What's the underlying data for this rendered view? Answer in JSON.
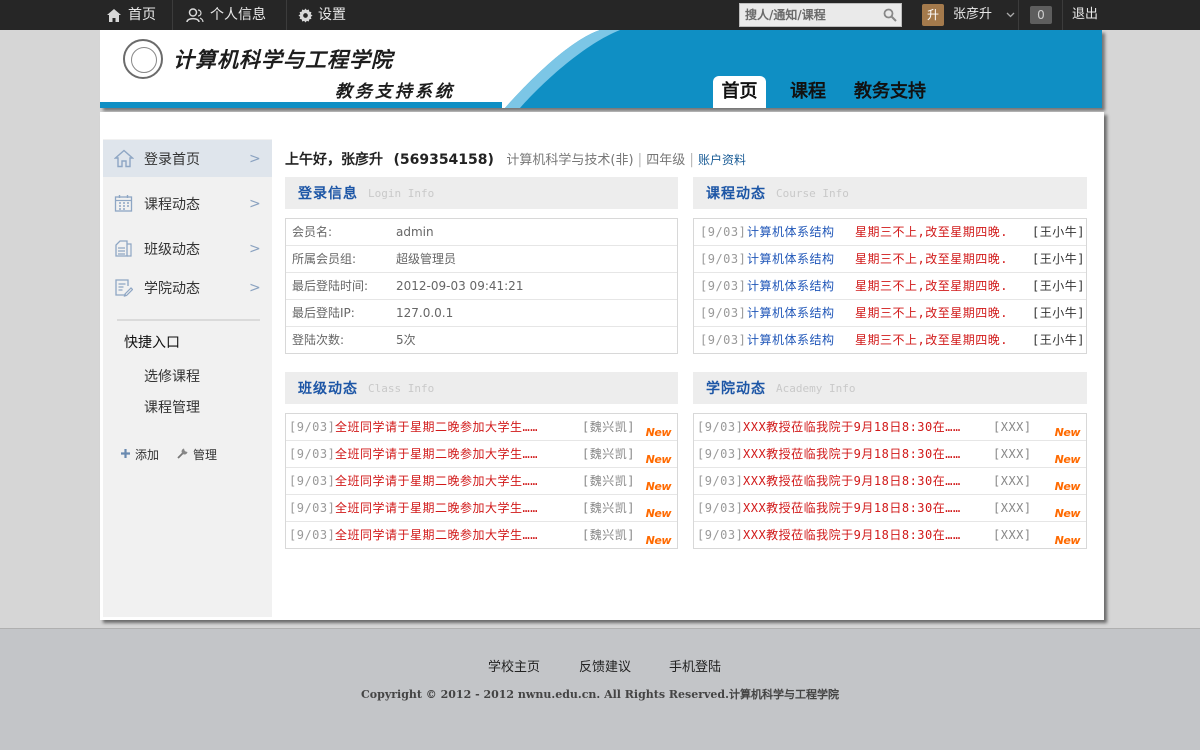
{
  "topbar": {
    "home_label": "首页",
    "profile_label": "个人信息",
    "settings_label": "设置",
    "search_placeholder": "搜人/通知/课程",
    "avatar_text": "升",
    "user_name": "张彦升",
    "notification_count": "0",
    "logout_label": "退出"
  },
  "header": {
    "site_title": "计算机科学与工程学院",
    "site_subtitle": "教务支持系统",
    "tabs": [
      "首页",
      "课程",
      "教务支持"
    ],
    "active_tab": "首页",
    "colors": {
      "banner": "#0f8fc4",
      "topbar": "#262626"
    }
  },
  "sidebar": {
    "items": [
      {
        "label": "登录首页",
        "arrow": ">",
        "icon": "home-icon"
      },
      {
        "label": "课程动态",
        "arrow": ">",
        "icon": "calendar-icon"
      },
      {
        "label": "班级动态",
        "arrow": ">",
        "icon": "class-icon"
      },
      {
        "label": "学院动态",
        "arrow": ">",
        "icon": "edit-icon"
      }
    ],
    "quick_title": "快捷入口",
    "quick_links": [
      "选修课程",
      "课程管理"
    ],
    "add_label": "添加",
    "manage_label": "管理"
  },
  "greeting": {
    "hello": "上午好，张彦升",
    "student_id": "(569354158)",
    "major": "计算机科学与技术(非)",
    "grade": "四年级",
    "account_link": "账户资料"
  },
  "login_info": {
    "title": "登录信息",
    "title_en": "Login Info",
    "rows": [
      {
        "key": "会员名:",
        "value": "admin"
      },
      {
        "key": "所属会员组:",
        "value": "超级管理员"
      },
      {
        "key": "最后登陆时间:",
        "value": "2012-09-03 09:41:21"
      },
      {
        "key": "最后登陆IP:",
        "value": "127.0.0.1"
      },
      {
        "key": "登陆次数:",
        "value": "5次"
      }
    ]
  },
  "course_news": {
    "title": "课程动态",
    "title_en": "Course Info",
    "rows": [
      {
        "date": "[9/03]",
        "course": "计算机体系结构",
        "text": "星期三不上,改至星期四晚.",
        "author": "[王小牛]"
      },
      {
        "date": "[9/03]",
        "course": "计算机体系结构",
        "text": "星期三不上,改至星期四晚.",
        "author": "[王小牛]"
      },
      {
        "date": "[9/03]",
        "course": "计算机体系结构",
        "text": "星期三不上,改至星期四晚.",
        "author": "[王小牛]"
      },
      {
        "date": "[9/03]",
        "course": "计算机体系结构",
        "text": "星期三不上,改至星期四晚.",
        "author": "[王小牛]"
      },
      {
        "date": "[9/03]",
        "course": "计算机体系结构",
        "text": "星期三不上,改至星期四晚.",
        "author": "[王小牛]"
      }
    ]
  },
  "class_news": {
    "title": "班级动态",
    "title_en": "Class Info",
    "rows": [
      {
        "date": "[9/03]",
        "text": "全班同学请于星期二晚参加大学生……",
        "author": "[魏兴凯]",
        "badge": "New"
      },
      {
        "date": "[9/03]",
        "text": "全班同学请于星期二晚参加大学生……",
        "author": "[魏兴凯]",
        "badge": "New"
      },
      {
        "date": "[9/03]",
        "text": "全班同学请于星期二晚参加大学生……",
        "author": "[魏兴凯]",
        "badge": "New"
      },
      {
        "date": "[9/03]",
        "text": "全班同学请于星期二晚参加大学生……",
        "author": "[魏兴凯]",
        "badge": "New"
      },
      {
        "date": "[9/03]",
        "text": "全班同学请于星期二晚参加大学生……",
        "author": "[魏兴凯]",
        "badge": "New"
      }
    ]
  },
  "academy_news": {
    "title": "学院动态",
    "title_en": "Academy Info",
    "rows": [
      {
        "date": "[9/03]",
        "text": "XXX教授莅临我院于9月18日8:30在……",
        "author": "[XXX]",
        "badge": "New"
      },
      {
        "date": "[9/03]",
        "text": "XXX教授莅临我院于9月18日8:30在……",
        "author": "[XXX]",
        "badge": "New"
      },
      {
        "date": "[9/03]",
        "text": "XXX教授莅临我院于9月18日8:30在……",
        "author": "[XXX]",
        "badge": "New"
      },
      {
        "date": "[9/03]",
        "text": "XXX教授莅临我院于9月18日8:30在……",
        "author": "[XXX]",
        "badge": "New"
      },
      {
        "date": "[9/03]",
        "text": "XXX教授莅临我院于9月18日8:30在……",
        "author": "[XXX]",
        "badge": "New"
      }
    ]
  },
  "footer": {
    "links": [
      "学校主页",
      "反馈建议",
      "手机登陆"
    ],
    "copyright": "Copyright © 2012 - 2012 nwnu.edu.cn. All Rights Reserved.计算机科学与工程学院"
  }
}
